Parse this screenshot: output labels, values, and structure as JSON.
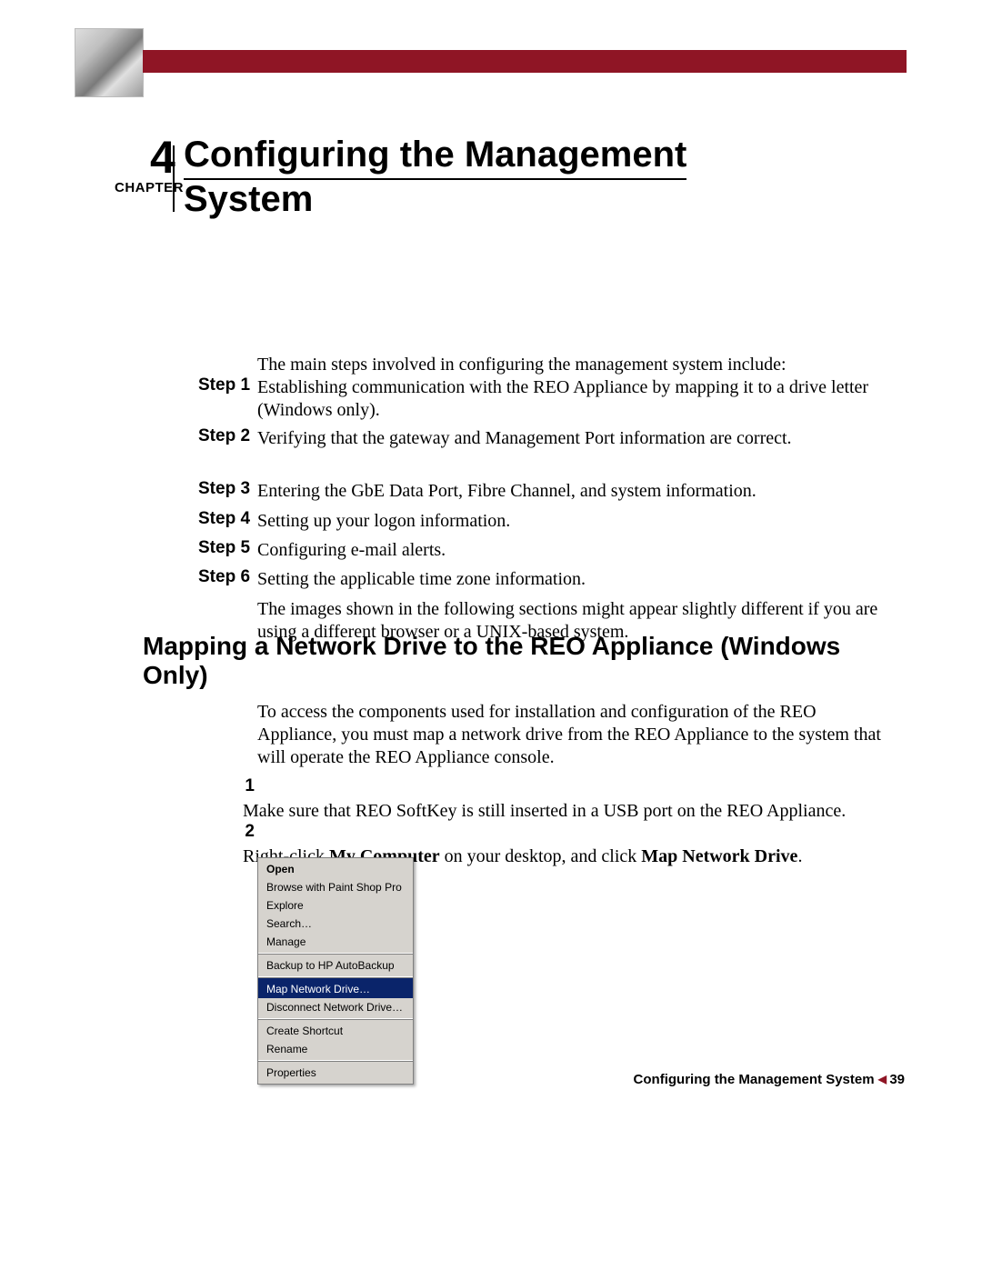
{
  "header": {
    "chapter_number": "4",
    "chapter_word": "CHAPTER",
    "title_line1": "Configuring the Management",
    "title_line2": "System"
  },
  "intro": "The main steps involved in configuring the management system include:",
  "steps": [
    {
      "label": "Step 1",
      "text": "Establishing communication with the REO Appliance by mapping it to a drive letter (Windows only)."
    },
    {
      "label": "Step 2",
      "text": "Verifying that the gateway and Management Port information are correct."
    },
    {
      "label": "Step 3",
      "text": "Entering the GbE Data Port, Fibre Channel, and system information."
    },
    {
      "label": "Step 4",
      "text": "Setting up your logon information."
    },
    {
      "label": "Step 5",
      "text": "Configuring e-mail alerts."
    },
    {
      "label": "Step 6",
      "text": "Setting the applicable time zone information."
    }
  ],
  "note": "The images shown in the following sections might appear slightly different if you are using a different browser or a UNIX-based system.",
  "section_title": "Mapping a Network Drive to the REO Appliance (Windows Only)",
  "section_para": "To access the components used for installation and configuration of the REO Appliance, you must map a network drive from the REO Appliance to the system that will operate the REO Appliance console.",
  "num_steps": {
    "n1": {
      "num": "1",
      "text": "Make sure that REO SoftKey is still inserted in a USB port on the REO Appliance."
    },
    "n2": {
      "num": "2",
      "pre": "Right-click ",
      "b1": "My Computer",
      "mid": " on your desktop, and click ",
      "b2": "Map Network Drive",
      "post": "."
    }
  },
  "context_menu": {
    "open": "Open",
    "browse": "Browse with Paint Shop Pro",
    "explore": "Explore",
    "search": "Search…",
    "manage": "Manage",
    "backup": "Backup to HP AutoBackup",
    "map": "Map Network Drive…",
    "disconnect": "Disconnect Network Drive…",
    "shortcut": "Create Shortcut",
    "rename": "Rename",
    "properties": "Properties"
  },
  "footer": {
    "title": "Configuring the Management System",
    "page": "39"
  }
}
